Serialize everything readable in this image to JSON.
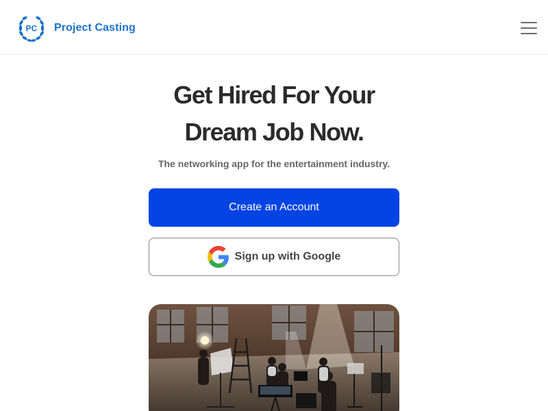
{
  "header": {
    "logo_text": "PC",
    "brand_name": "Project Casting",
    "menu_icon": "hamburger-menu-icon"
  },
  "hero": {
    "title_line1": "Get Hired For Your",
    "title_line2": "Dream Job Now.",
    "subtitle": "The networking app for the entertainment industry."
  },
  "actions": {
    "create_account_label": "Create an Account",
    "google_signup_label": "Sign up with Google",
    "google_icon": "google-g-icon"
  },
  "colors": {
    "brand_blue": "#1a73c9",
    "primary_button": "#0544e4",
    "google_blue": "#4285f4",
    "google_red": "#ea4335",
    "google_yellow": "#fbbc05",
    "google_green": "#34a853"
  },
  "media": {
    "hero_image": "film-set-photo"
  }
}
